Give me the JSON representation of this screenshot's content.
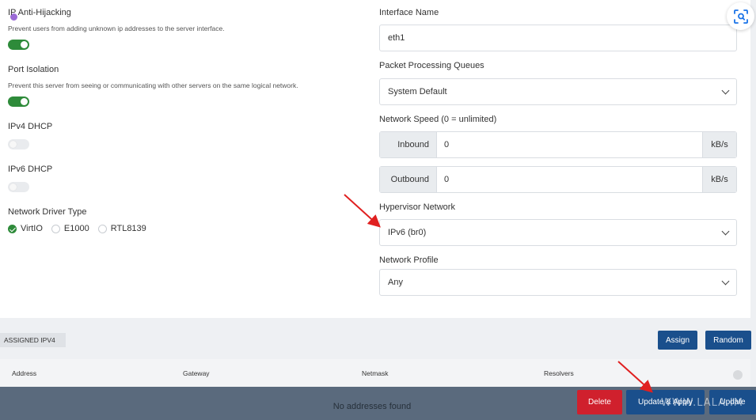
{
  "left": {
    "anti_hijacking": {
      "label": "IP Anti-Hijacking",
      "desc": "Prevent users from adding unknown ip addresses to the server interface."
    },
    "port_isolation": {
      "label": "Port Isolation",
      "desc": "Prevent this server from seeing or communicating with other servers on the same logical network."
    },
    "ipv4_dhcp": {
      "label": "IPv4 DHCP"
    },
    "ipv6_dhcp": {
      "label": "IPv6 DHCP"
    },
    "driver": {
      "label": "Network Driver Type",
      "options": [
        "VirtIO",
        "E1000",
        "RTL8139"
      ],
      "selected": "VirtIO"
    }
  },
  "right": {
    "interface": {
      "label": "Interface Name",
      "value": "eth1"
    },
    "queues": {
      "label": "Packet Processing Queues",
      "value": "System Default"
    },
    "speed": {
      "label": "Network Speed (0 = unlimited)",
      "inbound": {
        "prefix": "Inbound",
        "value": "0",
        "unit": "kB/s"
      },
      "outbound": {
        "prefix": "Outbound",
        "value": "0",
        "unit": "kB/s"
      }
    },
    "hypervisor": {
      "label": "Hypervisor Network",
      "value": "IPv6 (br0)"
    },
    "profile": {
      "label": "Network Profile",
      "value": "Any"
    }
  },
  "assigned": {
    "tag": "ASSIGNED IPV4",
    "assign": "Assign",
    "random": "Random",
    "columns": [
      "Address",
      "Gateway",
      "Netmask",
      "Resolvers"
    ],
    "empty": "No addresses found"
  },
  "footer": {
    "delete": "Delete",
    "update_apply": "Update & Apply",
    "update": "Update"
  },
  "watermark": "WWW.LALA.IM",
  "icons": {
    "scan": "scan-icon",
    "arrow": "red-arrow-annotation"
  },
  "colors": {
    "toggle_on": "#2e8b3a",
    "primary": "#1a4f8c",
    "danger": "#d0202d",
    "annotation": "#e02020"
  }
}
